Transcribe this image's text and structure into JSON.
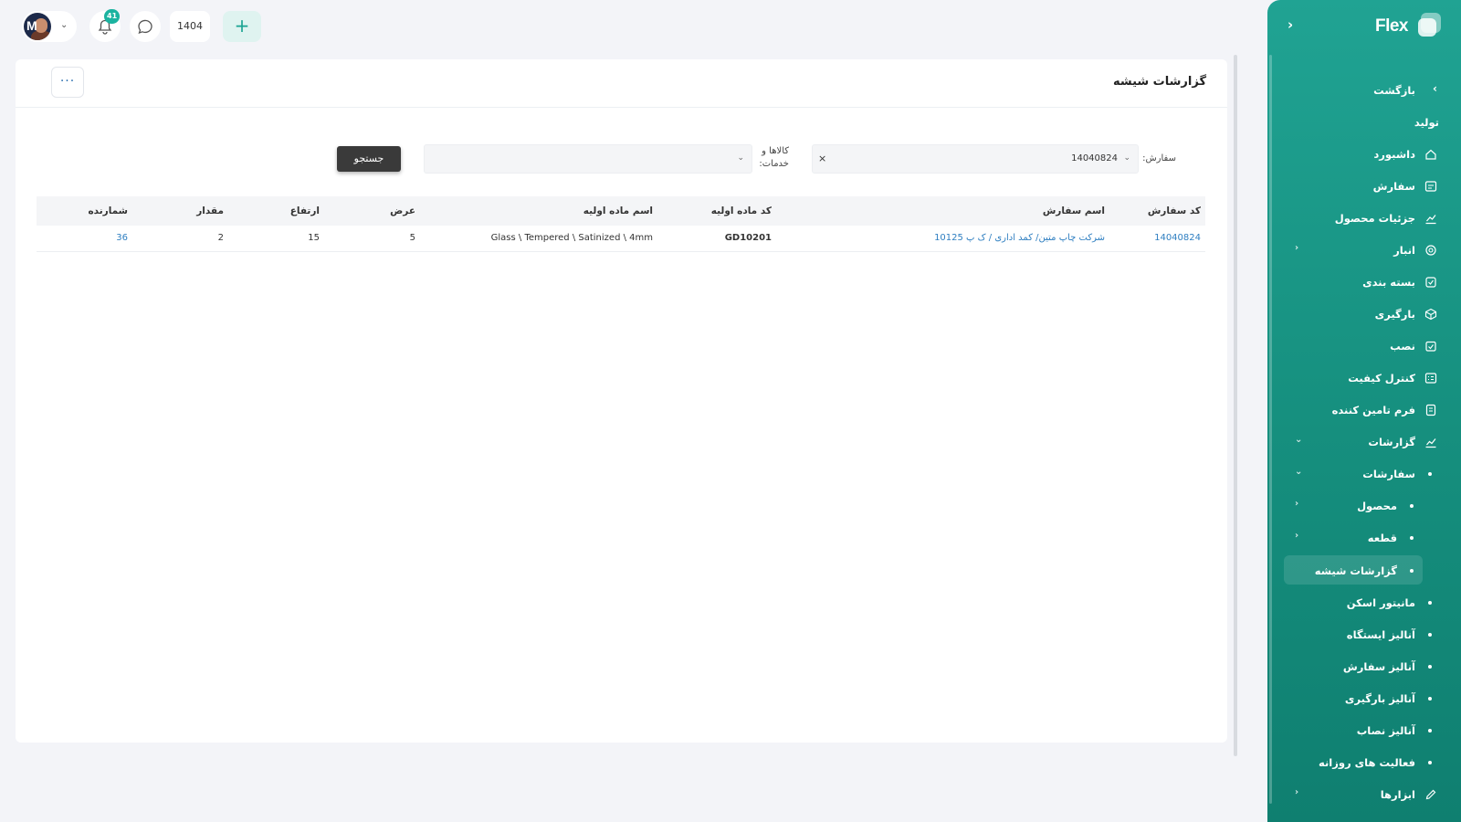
{
  "topbar": {
    "avatar_initial": "M",
    "notifications_count": "41",
    "year": "1404",
    "add_label": "+"
  },
  "page": {
    "title": "گزارشات شیشه",
    "more_label": "···"
  },
  "filters": {
    "order_label": "سفارش:",
    "order_value": "14040824",
    "clear_label": "×",
    "goods_label_line1": "کالاها و",
    "goods_label_line2": "خدمات:",
    "goods_value": "",
    "search_label": "جستجو"
  },
  "table": {
    "headers": [
      "کد سفارش",
      "اسم سفارش",
      "کد ماده اولیه",
      "اسم ماده اولیه",
      "عرض",
      "ارتفاع",
      "مقدار",
      "شمارنده"
    ],
    "rows": [
      [
        "14040824",
        "شرکت چاپ متین/ کمد اداری / ک پ 10125",
        "GD10201",
        "Glass \\ Tempered \\ Satinized \\ 4mm",
        "5",
        "15",
        "2",
        "36"
      ]
    ]
  },
  "sidebar": {
    "brand": "Flex",
    "collapse_icon": "‹",
    "items": [
      {
        "label": "بازگشت",
        "icon": "chevron-right-icon"
      },
      {
        "label": "تولید"
      },
      {
        "label": "داشبورد",
        "icon": "home-icon"
      },
      {
        "label": "سفارش",
        "icon": "order-icon"
      },
      {
        "label": "جزئیات محصول",
        "icon": "chart-icon"
      },
      {
        "label": "انبار",
        "icon": "warehouse-icon"
      },
      {
        "label": "بسته بندی",
        "icon": "package-icon"
      },
      {
        "label": "بارگیری",
        "icon": "box-icon"
      },
      {
        "label": "نصب",
        "icon": "install-icon"
      },
      {
        "label": "کنترل کیفیت",
        "icon": "quality-icon"
      },
      {
        "label": "فرم تامین کننده",
        "icon": "form-icon"
      },
      {
        "label": "گزارشات",
        "icon": "report-icon"
      },
      {
        "label": "سفارشات"
      },
      {
        "label": "محصول"
      },
      {
        "label": "قطعه"
      },
      {
        "label": "گزارشات شیشه"
      },
      {
        "label": "مانیتور اسکن"
      },
      {
        "label": "آنالیز ایستگاه"
      },
      {
        "label": "آنالیز سفارش"
      },
      {
        "label": "آنالیز بارگیری"
      },
      {
        "label": "آنالیز نصاب"
      },
      {
        "label": "فعالیت های روزانه"
      },
      {
        "label": "ابزارها",
        "icon": "pencil-icon"
      }
    ]
  }
}
